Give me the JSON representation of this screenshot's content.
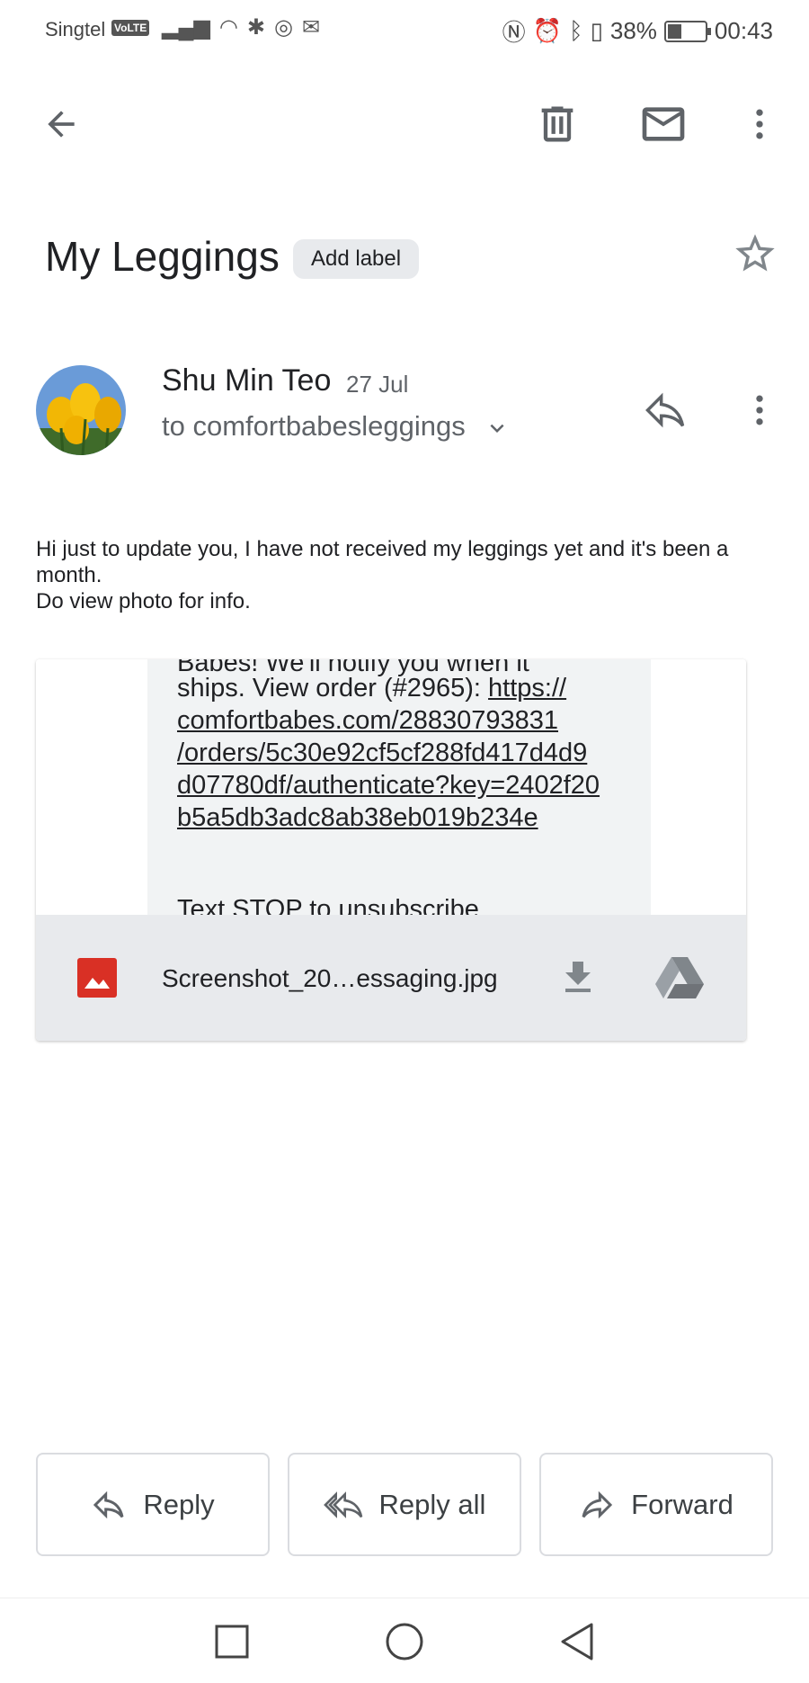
{
  "status_bar": {
    "carrier": "Singtel",
    "volte": "VoLTE",
    "battery": "38%",
    "battery_level": 0.38,
    "time": "00:43"
  },
  "toolbar": {
    "back_icon": "arrow-left-icon",
    "delete_icon": "trash-icon",
    "mark_unread_icon": "mail-icon",
    "more_icon": "more-vert-icon"
  },
  "email": {
    "subject": "My Leggings",
    "add_label": "Add label",
    "sender_name": "Shu Min Teo",
    "date": "27 Jul",
    "recipient": "to comfortbabesleggings",
    "body_line1": "Hi just to update you, I have not received my leggings yet and it's been a month.",
    "body_line2": "Do view photo for info."
  },
  "attachment": {
    "preview_partial_top": "Babes! We'll notify you when it",
    "preview_text_prefix": "ships. View order (#2965): ",
    "preview_link": "https://comfortbabes.com/28830793831/orders/5c30e92cf5cf288fd417d4d9d07780df/authenticate?key=2402f20b5a5db3adc8ab38eb019b234e",
    "preview_link_lines": [
      "https://",
      "comfortbabes.com/28830793831",
      "/orders/5c30e92cf5cf288fd417d4d9",
      "d07780df/authenticate?key=2402f20",
      "b5a5db3adc8ab38eb019b234e"
    ],
    "preview_footer": "Text STOP to unsubscribe",
    "file_name": "Screenshot_20…essaging.jpg"
  },
  "actions": {
    "reply": "Reply",
    "reply_all": "Reply all",
    "forward": "Forward"
  },
  "colors": {
    "image_icon": "#d93025",
    "icon_gray": "#5f6368",
    "chip_bg": "#e8eaed"
  }
}
